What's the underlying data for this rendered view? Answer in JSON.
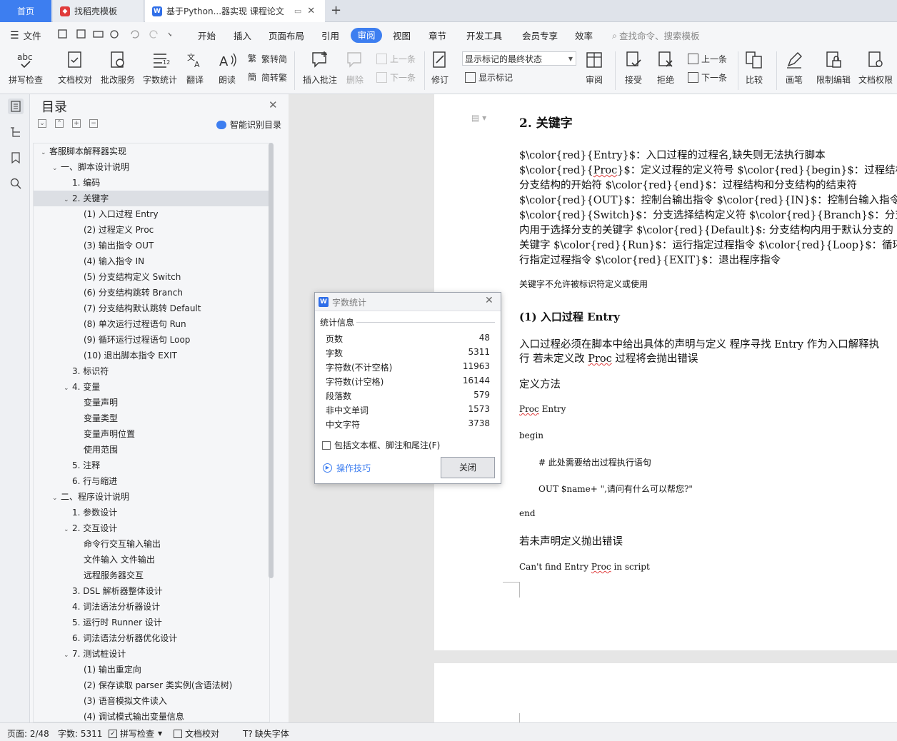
{
  "tabs": {
    "home": "首页",
    "template": "找稻壳模板",
    "document": "基于Python...器实现 课程论文",
    "new_tab": "+"
  },
  "menu": {
    "file": "文件",
    "items": [
      "开始",
      "插入",
      "页面布局",
      "引用",
      "审阅",
      "视图",
      "章节",
      "开发工具",
      "会员专享",
      "效率"
    ],
    "search": "查找命令、搜索模板"
  },
  "ribbon": {
    "spell": "拼写检查",
    "proof": "文档校对",
    "batch": "批改服务",
    "wordcount": "字数统计",
    "translate": "翻译",
    "read": "朗读",
    "trad": "繁转简",
    "simp": "简转繁",
    "insert_comment": "插入批注",
    "delete": "删除",
    "prev": "上一条",
    "next": "下一条",
    "track": "修订",
    "markup_state": "显示标记的最终状态",
    "show_markup": "显示标记",
    "review": "审阅",
    "accept": "接受",
    "reject": "拒绝",
    "prev2": "上一条",
    "next2": "下一条",
    "compare": "比较",
    "pen": "画笔",
    "restrict": "限制编辑",
    "permission": "文档权限"
  },
  "toc": {
    "title": "目录",
    "smart": "智能识别目录",
    "items": [
      "客服脚本解释器实现",
      "一、脚本设计说明",
      "1. 编码",
      "2. 关键字",
      "(1) 入口过程 Entry",
      "(2) 过程定义 Proc",
      "(3) 输出指令 OUT",
      "(4) 输入指令 IN",
      "(5) 分支结构定义 Switch",
      "(6) 分支结构跳转 Branch",
      "(7) 分支结构默认跳转 Default",
      "(8) 单次运行过程语句 Run",
      "(9) 循环运行过程语句 Loop",
      "(10) 退出脚本指令 EXIT",
      "3. 标识符",
      "4. 变量",
      "变量声明",
      "变量类型",
      "变量声明位置",
      "使用范围",
      "5. 注释",
      "6. 行与缩进",
      "二、程序设计说明",
      "1. 参数设计",
      "2. 交互设计",
      "命令行交互输入输出",
      "文件输入 文件输出",
      "远程服务器交互",
      "3. DSL 解析器整体设计",
      "4. 词法语法分析器设计",
      "5. 运行时 Runner 设计",
      "6. 词法语法分析器优化设计",
      "7. 测试桩设计",
      "(1) 输出重定向",
      "(2) 保存读取 parser 类实例(含语法树)",
      "(3) 语音模拟文件读入",
      "(4) 调试模式输出变量信息"
    ]
  },
  "doc": {
    "heading": "2.  关键字",
    "line1": "$\\color{red}{Entry}$：入口过程的过程名,缺失则无法执行脚本",
    "line2a": "$\\color{red}{",
    "line2b": "Proc",
    "line2c": "}$：定义过程的定义符号  $\\color{red}{begin}$：过程结构和",
    "line3": "分支结构的开始符  $\\color{red}{end}$：过程结构和分支结构的结束符",
    "line4": "$\\color{red}{OUT}$：控制台输出指令  $\\color{red}{IN}$：控制台输入指令",
    "line5": "$\\color{red}{Switch}$：分支选择结构定义符  $\\color{red}{Branch}$：分支结",
    "line6": "内用于选择分支的关键字  $\\color{red}{Default}$: 分支结构内用于默认分支的",
    "line7": "关键字  $\\color{red}{Run}$：运行指定过程指令  $\\color{red}{Loop}$：循环运",
    "line8": "行指定过程指令  $\\color{red}{EXIT}$：退出程序指令",
    "note": "关键字不允许被标识符定义或使用",
    "subheading": "(1)  入口过程 Entry",
    "para1": "入口过程必须在脚本中给出具体的声明与定义  程序寻找 Entry 作为入口解释执",
    "para2a": "行  若未定义改 ",
    "para2b": "Proc",
    "para2c": " 过程将会抛出错误",
    "define": "定义方法",
    "code1a": "Proc",
    "code1b": " Entry",
    "code2": "begin",
    "code3": "#  此处需要给出过程执行语句",
    "code4": "OUT $name+ \",请问有什么可以帮您?\"",
    "code5": "end",
    "error_title": "若未声明定义抛出错误",
    "error_msg_a": "Can't find Entry ",
    "error_msg_b": "Proc",
    "error_msg_c": " in script"
  },
  "dialog": {
    "title": "字数统计",
    "section": "统计信息",
    "rows": [
      {
        "label": "页数",
        "value": "48"
      },
      {
        "label": "字数",
        "value": "5311"
      },
      {
        "label": "字符数(不计空格)",
        "value": "11963"
      },
      {
        "label": "字符数(计空格)",
        "value": "16144"
      },
      {
        "label": "段落数",
        "value": "579"
      },
      {
        "label": "非中文单词",
        "value": "1573"
      },
      {
        "label": "中文字符",
        "value": "3738"
      }
    ],
    "checkbox": "包括文本框、脚注和尾注(F)",
    "tips": "操作技巧",
    "close": "关闭"
  },
  "status": {
    "page": "页面: 2/48",
    "words": "字数: 5311",
    "spell": "拼写检查",
    "proof": "文档校对",
    "font": "缺失字体"
  }
}
